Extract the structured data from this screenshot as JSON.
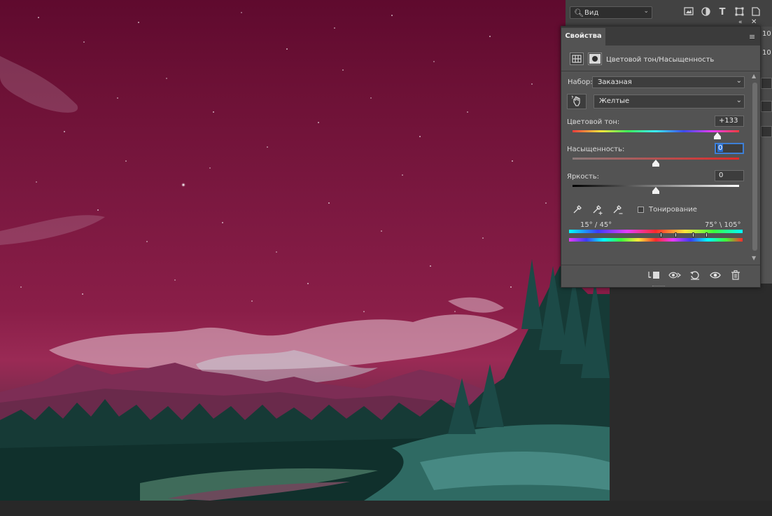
{
  "top_toolbar": {
    "kind_filter_label": "Вид"
  },
  "right_strip": {
    "values": [
      "10",
      "10"
    ]
  },
  "properties": {
    "tab_label": "Свойства",
    "adjustment_title": "Цветовой тон/Насыщенность",
    "preset": {
      "label": "Набор:",
      "value": "Заказная"
    },
    "channel": {
      "value": "Желтые"
    },
    "hue": {
      "label": "Цветовой тон:",
      "value": "+133",
      "slider_fraction": 0.87
    },
    "saturation": {
      "label": "Насыщенность:",
      "value": "0",
      "slider_fraction": 0.5
    },
    "lightness": {
      "label": "Яркость:",
      "value": "0",
      "slider_fraction": 0.5
    },
    "colorize_label": "Тонирование",
    "colorize_checked": false,
    "range": {
      "left": "15° /  45°",
      "right": "75° \\  105°"
    }
  },
  "colors": {
    "accent": "#3d7fd6",
    "panel": "#535353",
    "sky": "#7b1840"
  }
}
